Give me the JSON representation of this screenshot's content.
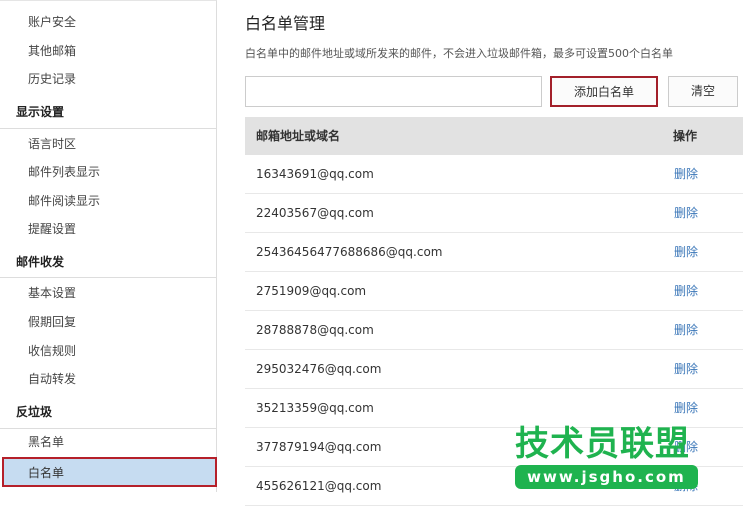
{
  "sidebar": {
    "items_a": [
      "账户安全",
      "其他邮箱",
      "历史记录"
    ],
    "group_display": "显示设置",
    "items_b": [
      "语言时区",
      "邮件列表显示",
      "邮件阅读显示",
      "提醒设置"
    ],
    "group_mail": "邮件收发",
    "items_c": [
      "基本设置",
      "假期回复",
      "收信规则",
      "自动转发"
    ],
    "group_spam": "反垃圾",
    "items_d": [
      "黑名单"
    ],
    "selected": "白名单"
  },
  "main": {
    "title": "白名单管理",
    "description": "白名单中的邮件地址或域所发来的邮件，不会进入垃圾邮件箱，最多可设置500个白名单",
    "input_value": "",
    "add_label": "添加白名单",
    "clear_label": "清空",
    "columns": [
      "邮箱地址或域名",
      "操作"
    ],
    "rows": [
      {
        "email": "16343691@qq.com",
        "action": "删除"
      },
      {
        "email": "22403567@qq.com",
        "action": "删除"
      },
      {
        "email": "25436456477688686@qq.com",
        "action": "删除"
      },
      {
        "email": "2751909@qq.com",
        "action": "删除"
      },
      {
        "email": "28788878@qq.com",
        "action": "删除"
      },
      {
        "email": "295032476@qq.com",
        "action": "删除"
      },
      {
        "email": "35213359@qq.com",
        "action": "删除"
      },
      {
        "email": "377879194@qq.com",
        "action": "删除"
      },
      {
        "email": "455626121@qq.com",
        "action": "删除"
      }
    ]
  },
  "watermark": {
    "title": "技术员联盟",
    "url": "www.jsgho.com"
  }
}
